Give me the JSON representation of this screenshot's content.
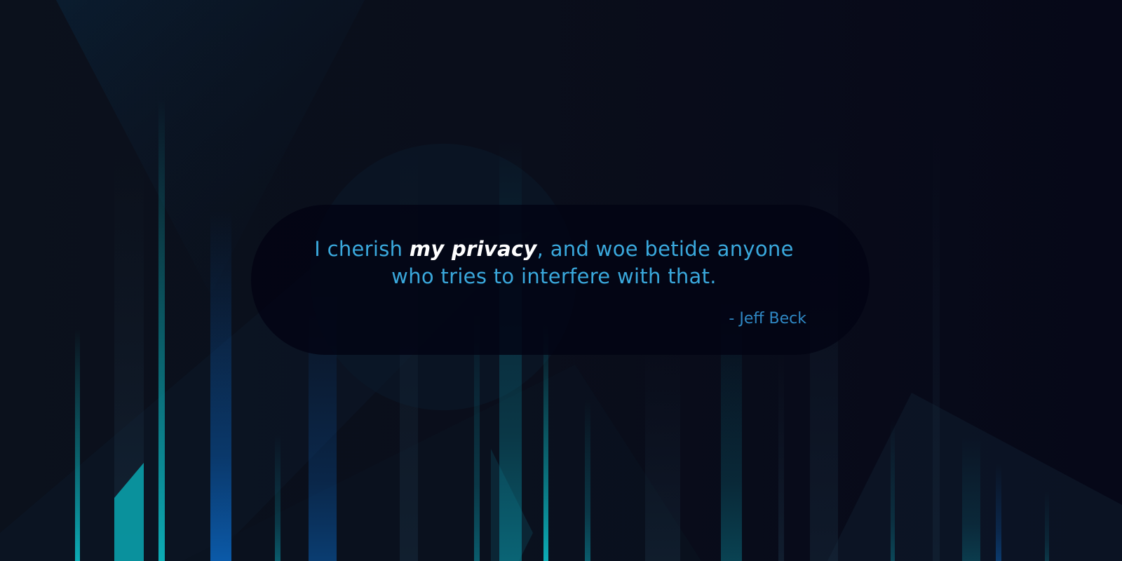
{
  "quote": {
    "before_emphasis": "I cherish ",
    "emphasis": "my privacy",
    "line1_after_emphasis": ", and woe betide anyone",
    "line2": "who tries to interfere with that.",
    "author": "- Jeff Beck"
  },
  "colors": {
    "quote_text": "#3aa8dc",
    "emphasis_text": "#ffffff",
    "author_text": "#2f88c4",
    "card_background": "#020414",
    "page_background": "#0a0f1c",
    "accent_teal": "#0aa3ad",
    "accent_blue": "#0a5aa8"
  }
}
